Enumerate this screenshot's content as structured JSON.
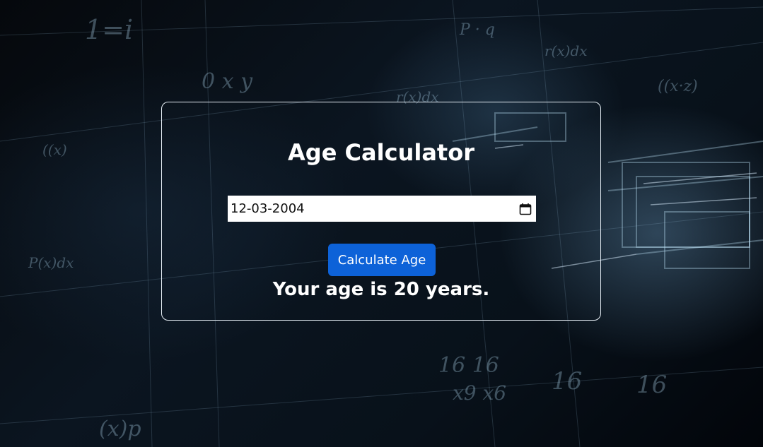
{
  "app": {
    "title": "Age Calculator"
  },
  "form": {
    "birthdate_value": "12-03-2004",
    "calendar_icon": "calendar-icon",
    "calculate_label": "Calculate Age"
  },
  "result": {
    "text": "Your age is 20 years."
  },
  "colors": {
    "button": "#0d62d8",
    "card_border": "#e6eef5",
    "text": "#ffffff"
  }
}
